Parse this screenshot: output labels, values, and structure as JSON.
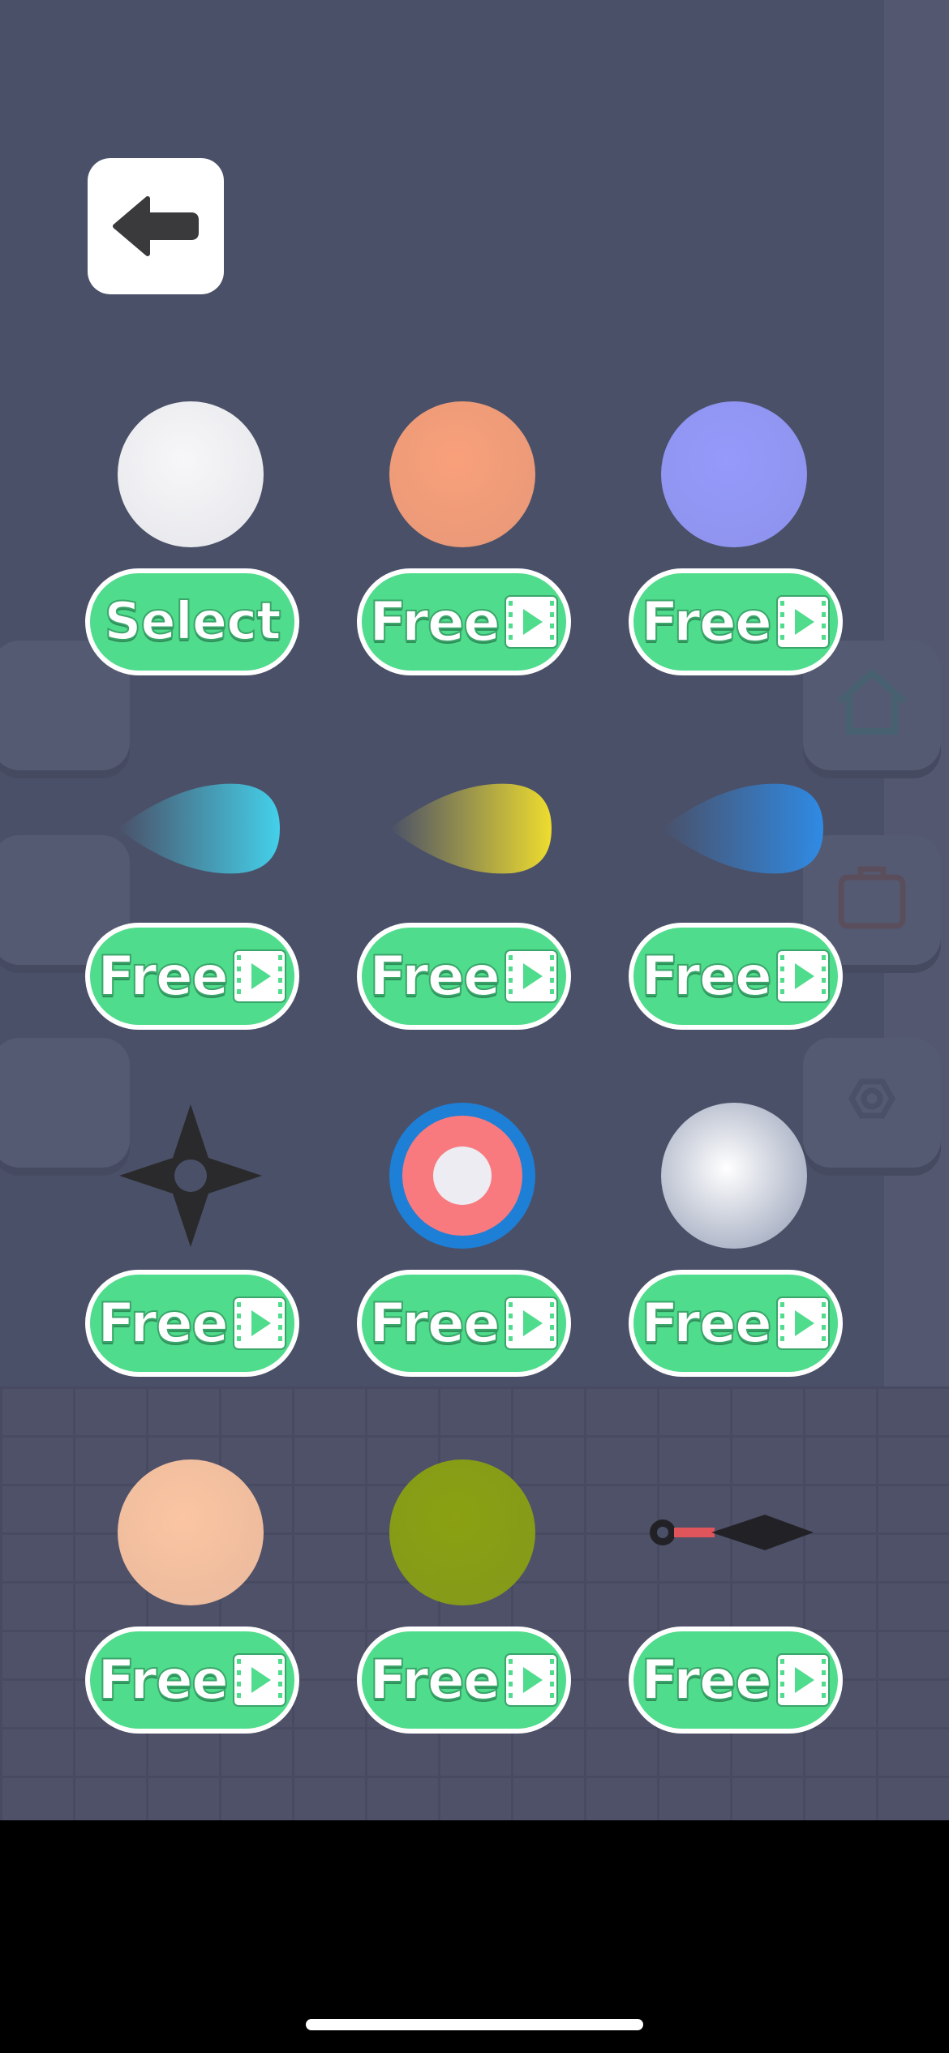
{
  "back_button": {
    "icon": "arrow-left-icon"
  },
  "skins": [
    {
      "shape": "circle",
      "color": "#f7f7f9",
      "button": "Select"
    },
    {
      "shape": "circle",
      "color": "#f9a07a",
      "button": "Free"
    },
    {
      "shape": "circle",
      "color": "#959afb",
      "button": "Free"
    },
    {
      "shape": "drop",
      "color": "#44d0ea",
      "button": "Free"
    },
    {
      "shape": "drop",
      "color": "#eedc2e",
      "button": "Free"
    },
    {
      "shape": "drop",
      "color": "#2f8ae4",
      "button": "Free"
    },
    {
      "shape": "shuriken",
      "color": "#2a2a2c",
      "button": "Free"
    },
    {
      "shape": "target",
      "color": "#f87a7e",
      "button": "Free"
    },
    {
      "shape": "pearl",
      "color": "#d6dbe6",
      "button": "Free"
    },
    {
      "shape": "circle",
      "color": "#fbc5a2",
      "button": "Free"
    },
    {
      "shape": "circle",
      "color": "#8aa112",
      "button": "Free"
    },
    {
      "shape": "kunai",
      "color": "#222226",
      "button": "Free"
    }
  ],
  "button_icon": "video-play-icon",
  "colors": {
    "button_green": "#4fdc8c",
    "overlay": "#4a5068"
  }
}
